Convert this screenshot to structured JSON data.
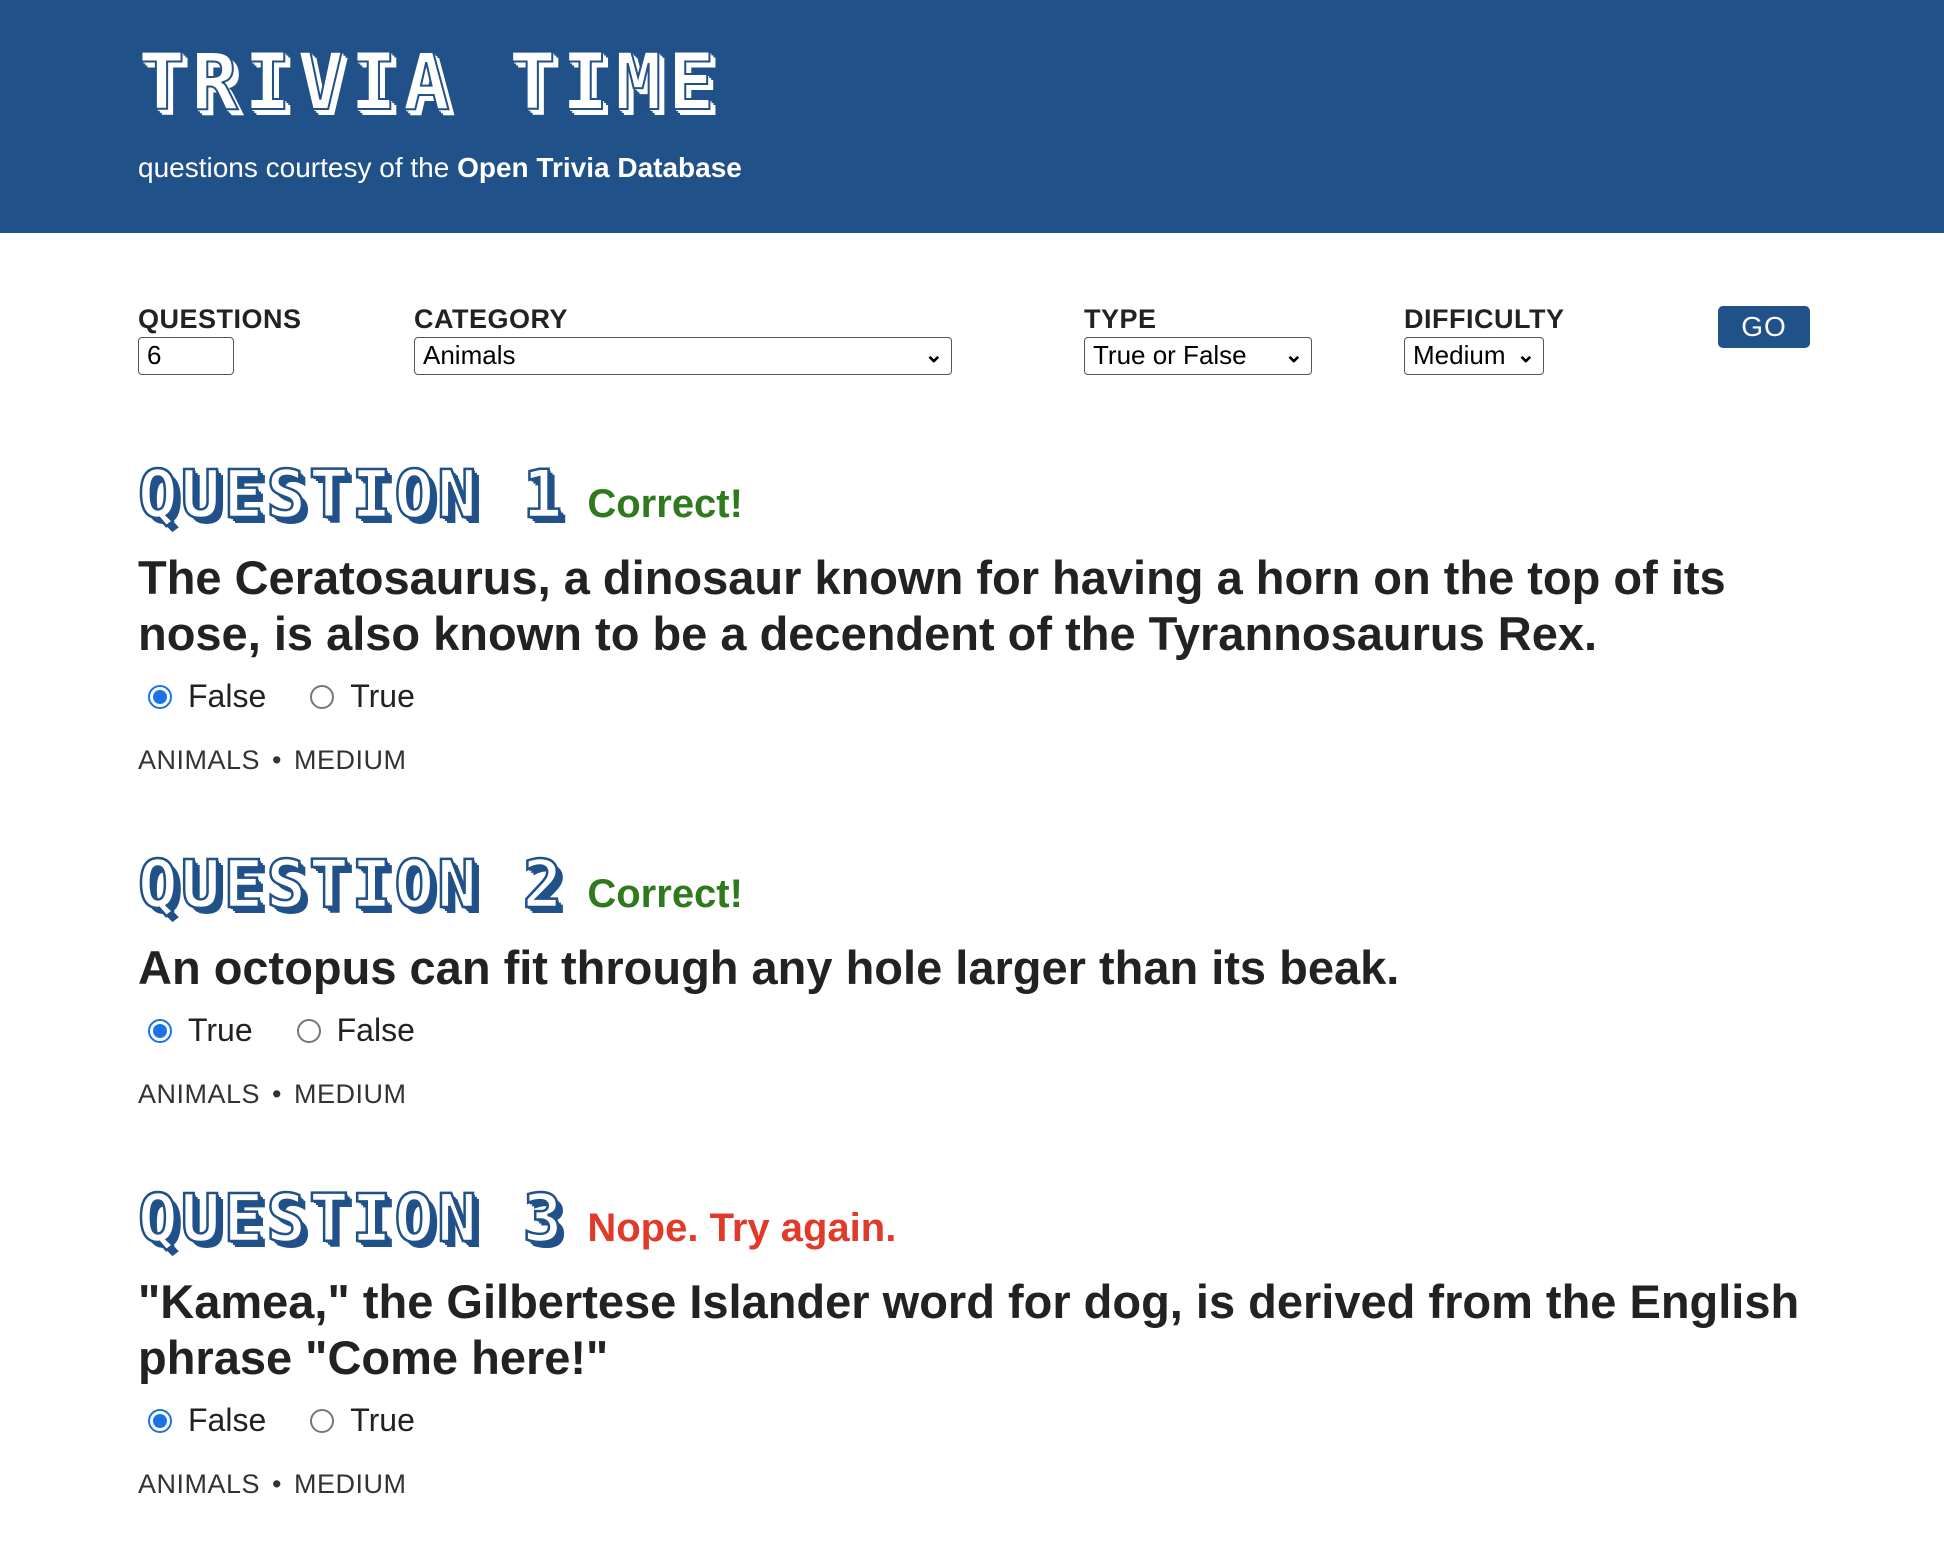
{
  "header": {
    "title": "TRIVIA TIME",
    "tagline_prefix": "questions courtesy of the",
    "tagline_source": "Open Trivia Database"
  },
  "controls": {
    "questions_label": "QUESTIONS",
    "questions_value": "6",
    "category_label": "CATEGORY",
    "category_value": "Animals",
    "type_label": "TYPE",
    "type_value": "True or False",
    "difficulty_label": "DIFFICULTY",
    "difficulty_value": "Medium",
    "go_label": "GO"
  },
  "questions": [
    {
      "title": "QUESTION 1",
      "status": "Correct!",
      "text": "The Ceratosaurus, a dinosaur known for having a horn on the top of its nose, is also known to be a decendent of the Tyrannosaurus Rex.",
      "answers": [
        {
          "label": "False",
          "checked": true
        },
        {
          "label": "True",
          "checked": false
        }
      ],
      "category": "ANIMALS",
      "difficulty": "MEDIUM"
    },
    {
      "title": "QUESTION 2",
      "status": "Correct!",
      "text": "An octopus can fit through any hole larger than its beak.",
      "answers": [
        {
          "label": "True",
          "checked": true
        },
        {
          "label": "False",
          "checked": false
        }
      ],
      "category": "ANIMALS",
      "difficulty": "MEDIUM"
    },
    {
      "title": "QUESTION 3",
      "status": "Nope. Try again.",
      "text": "\"Kamea,\" the Gilbertese Islander word for dog, is derived from the English phrase \"Come here!\"",
      "answers": [
        {
          "label": "False",
          "checked": true
        },
        {
          "label": "True",
          "checked": false
        }
      ],
      "category": "ANIMALS",
      "difficulty": "MEDIUM"
    }
  ],
  "meta_separator": "•",
  "colors": {
    "brand_blue": "#215189",
    "correct_green": "#2f7a1c",
    "wrong_red": "#e03a2a",
    "radio_blue": "#1a73e8"
  }
}
